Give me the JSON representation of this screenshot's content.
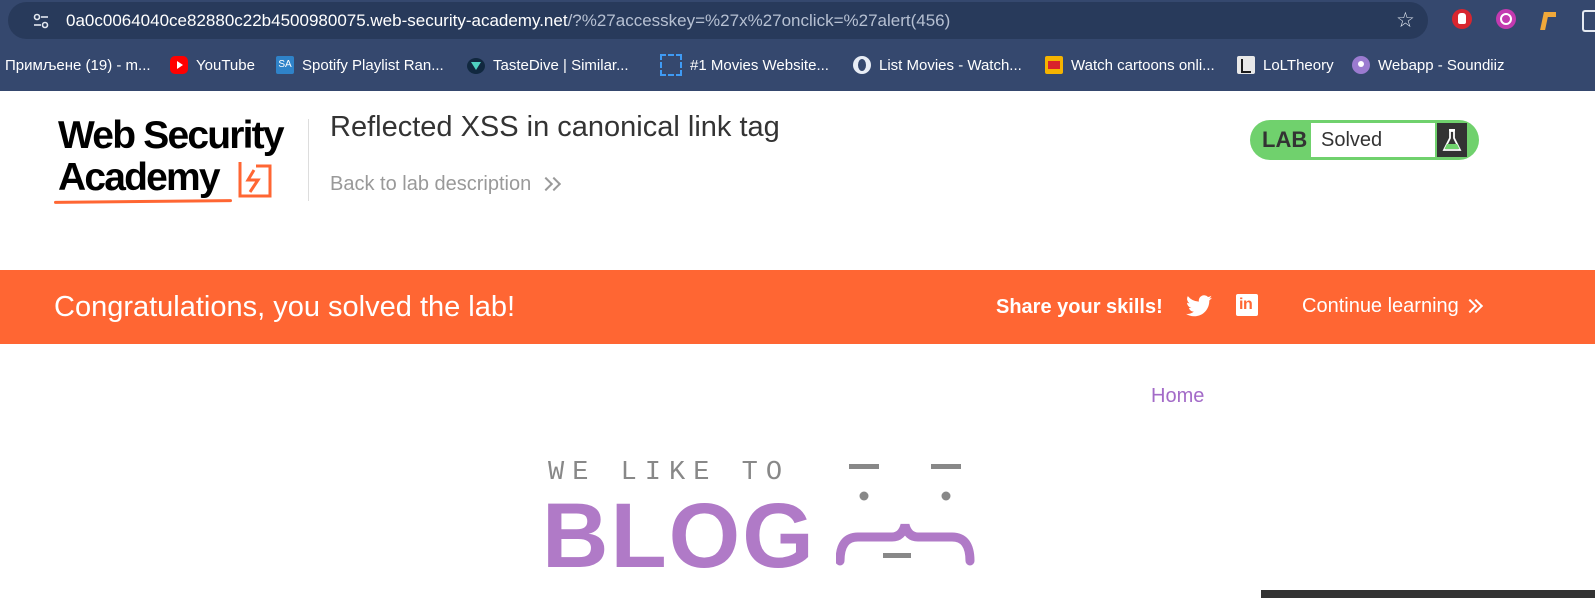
{
  "browser": {
    "url_host": "0a0c0064040ce82880c22b4500980075.web-security-academy.net",
    "url_path": "/?%27accesskey=%27x%27onclick=%27alert(456)",
    "bookmarks": [
      {
        "label": "Примљене (19) - m...",
        "icon": ""
      },
      {
        "label": "YouTube",
        "icon": "youtube-icon"
      },
      {
        "label": "Spotify Playlist Ran...",
        "icon": "sa-icon"
      },
      {
        "label": "TasteDive | Similar...",
        "icon": "tastedive-icon"
      },
      {
        "label": "#1 Movies Website...",
        "icon": "movies-icon"
      },
      {
        "label": "List Movies - Watch...",
        "icon": "globe-icon"
      },
      {
        "label": "Watch cartoons onli...",
        "icon": "cartoons-icon"
      },
      {
        "label": "LoLTheory",
        "icon": "loltheory-icon"
      },
      {
        "label": "Webapp - Soundiiz",
        "icon": "soundiiz-icon"
      }
    ]
  },
  "lab_header": {
    "logo_line1": "Web Security",
    "logo_line2": "Academy",
    "title": "Reflected XSS in canonical link tag",
    "back_link": "Back to lab description",
    "badge_label": "LAB",
    "status": "Solved"
  },
  "banner": {
    "message": "Congratulations, you solved the lab!",
    "share": "Share your skills!",
    "continue": "Continue learning"
  },
  "blog": {
    "nav_home": "Home",
    "tagline": "WE LIKE TO",
    "word": "BLOG"
  },
  "colors": {
    "accent": "#ff6633",
    "lab_green": "#70d16d",
    "blog_purple": "#b07ac7",
    "chrome_bg": "#35486e"
  }
}
